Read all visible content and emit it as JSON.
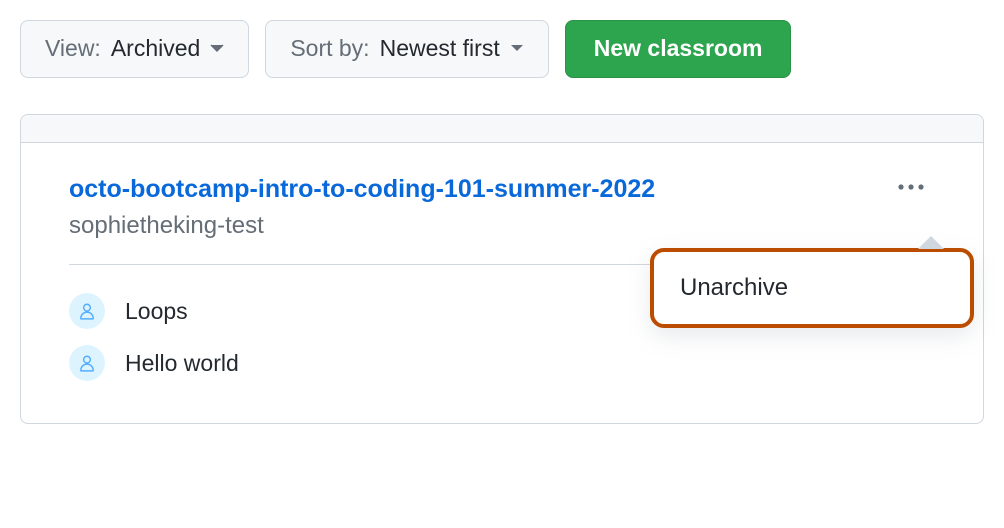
{
  "toolbar": {
    "view": {
      "label": "View:",
      "value": "Archived"
    },
    "sort": {
      "label": "Sort by:",
      "value": "Newest first"
    },
    "new_classroom": "New classroom"
  },
  "classroom": {
    "title": "octo-bootcamp-intro-to-coding-101-summer-2022",
    "org": "sophietheking-test",
    "assignments": [
      {
        "name": "Loops"
      },
      {
        "name": "Hello world"
      }
    ]
  },
  "dropdown": {
    "unarchive": "Unarchive"
  }
}
